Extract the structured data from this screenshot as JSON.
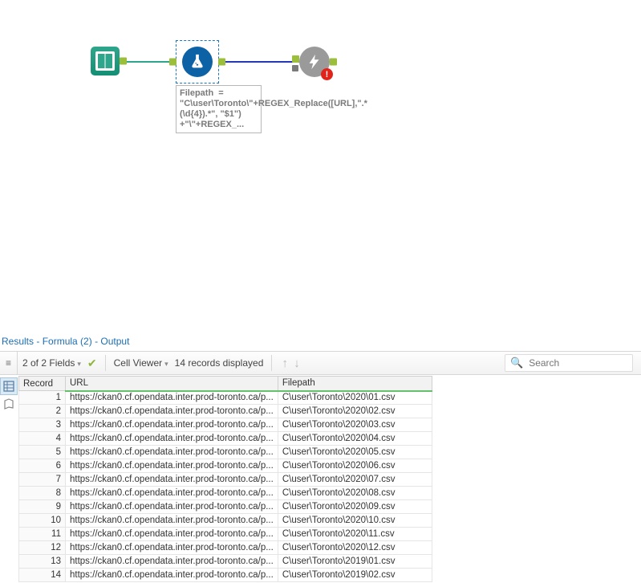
{
  "results_title": {
    "p1": "Results",
    "p2": "Formula (2)",
    "p3": "Output"
  },
  "toolbar": {
    "fields": "2 of 2 Fields",
    "cellviewer": "Cell Viewer",
    "records": "14 records displayed",
    "search_placeholder": "Search"
  },
  "formula_label": "Filepath  = \"C\\user\\Toronto\\\"+REGEX_Replace([URL],\".*(\\d{4}).*\", \"$1\")\n+\"\\\"+REGEX_...",
  "columns": {
    "rec": "Record",
    "url": "URL",
    "fp": "Filepath"
  },
  "rows": [
    {
      "n": "1",
      "url": "https://ckan0.cf.opendata.inter.prod-toronto.ca/p...",
      "fp": "C\\user\\Toronto\\2020\\01.csv"
    },
    {
      "n": "2",
      "url": "https://ckan0.cf.opendata.inter.prod-toronto.ca/p...",
      "fp": "C\\user\\Toronto\\2020\\02.csv"
    },
    {
      "n": "3",
      "url": "https://ckan0.cf.opendata.inter.prod-toronto.ca/p...",
      "fp": "C\\user\\Toronto\\2020\\03.csv"
    },
    {
      "n": "4",
      "url": "https://ckan0.cf.opendata.inter.prod-toronto.ca/p...",
      "fp": "C\\user\\Toronto\\2020\\04.csv"
    },
    {
      "n": "5",
      "url": "https://ckan0.cf.opendata.inter.prod-toronto.ca/p...",
      "fp": "C\\user\\Toronto\\2020\\05.csv"
    },
    {
      "n": "6",
      "url": "https://ckan0.cf.opendata.inter.prod-toronto.ca/p...",
      "fp": "C\\user\\Toronto\\2020\\06.csv"
    },
    {
      "n": "7",
      "url": "https://ckan0.cf.opendata.inter.prod-toronto.ca/p...",
      "fp": "C\\user\\Toronto\\2020\\07.csv"
    },
    {
      "n": "8",
      "url": "https://ckan0.cf.opendata.inter.prod-toronto.ca/p...",
      "fp": "C\\user\\Toronto\\2020\\08.csv"
    },
    {
      "n": "9",
      "url": "https://ckan0.cf.opendata.inter.prod-toronto.ca/p...",
      "fp": "C\\user\\Toronto\\2020\\09.csv"
    },
    {
      "n": "10",
      "url": "https://ckan0.cf.opendata.inter.prod-toronto.ca/p...",
      "fp": "C\\user\\Toronto\\2020\\10.csv"
    },
    {
      "n": "11",
      "url": "https://ckan0.cf.opendata.inter.prod-toronto.ca/p...",
      "fp": "C\\user\\Toronto\\2020\\11.csv"
    },
    {
      "n": "12",
      "url": "https://ckan0.cf.opendata.inter.prod-toronto.ca/p...",
      "fp": "C\\user\\Toronto\\2020\\12.csv"
    },
    {
      "n": "13",
      "url": "https://ckan0.cf.opendata.inter.prod-toronto.ca/p...",
      "fp": "C\\user\\Toronto\\2019\\01.csv"
    },
    {
      "n": "14",
      "url": "https://ckan0.cf.opendata.inter.prod-toronto.ca/p...",
      "fp": "C\\user\\Toronto\\2019\\02.csv"
    }
  ]
}
